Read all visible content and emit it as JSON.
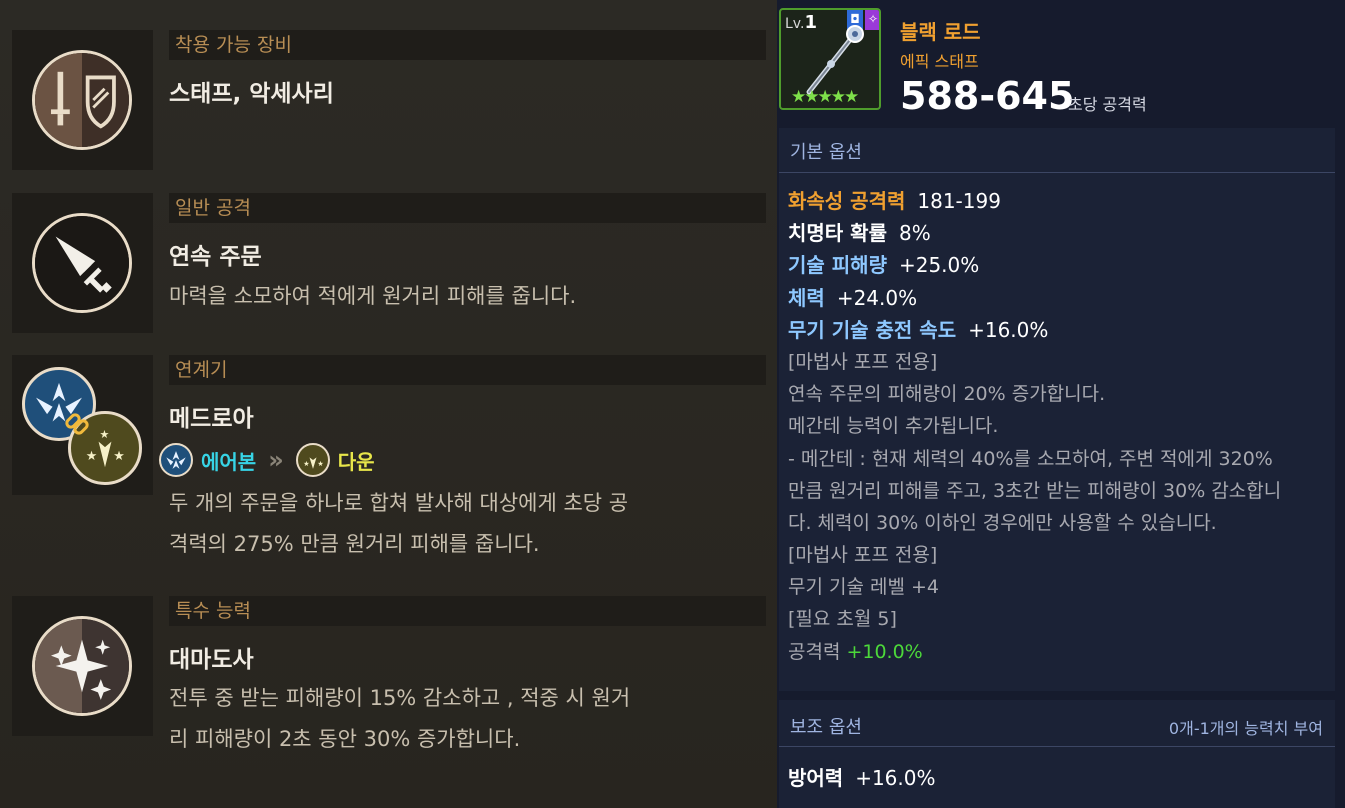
{
  "left": {
    "equip": {
      "header": "착용 가능 장비",
      "title": "스태프, 악세사리",
      "icon": "sword-shield-icon"
    },
    "normal_attack": {
      "header": "일반 공격",
      "title": "연속 주문",
      "desc": "마력을 소모하여 적에게 원거리 피해를 줍니다.",
      "icon": "sword-icon"
    },
    "combo": {
      "header": "연계기",
      "title": "메드로아",
      "skill_a": "에어본",
      "skill_b": "다운",
      "arrow": "»",
      "desc_line1": "두 개의 주문을 하나로 합쳐 발사해 대상에게 초당 공",
      "desc_line2": "격력의 275% 만큼 원거리 피해를 줍니다.",
      "icon": "chain-link-icon"
    },
    "special": {
      "header": "특수 능력",
      "title": "대마도사",
      "desc_line1": "전투 중 받는 피해량이 15% 감소하고 , 적중 시 원거",
      "desc_line2": "리 피해량이 2초 동안 30% 증가합니다.",
      "icon": "sparkle-icon"
    }
  },
  "item": {
    "level_prefix": "Lv.",
    "level": "1",
    "stars": "★★★★★",
    "name": "블랙 로드",
    "type": "에픽 스태프",
    "dps": "588-645",
    "dps_label": "초당 공격력"
  },
  "base_options": {
    "header": "기본 옵션",
    "rows": [
      {
        "key": "화속성 공격력",
        "value": "181-199",
        "key_color": "#f0a030"
      },
      {
        "key": "치명타 확률",
        "value": "8%",
        "key_color": "#ffffff"
      },
      {
        "key": "기술 피해량",
        "value": "+25.0%",
        "key_color": "#8ec8ff"
      },
      {
        "key": "체력",
        "value": "+24.0%",
        "key_color": "#8ec8ff"
      },
      {
        "key": "무기 기술 충전 속도",
        "value": "+16.0%",
        "key_color": "#8ec8ff"
      }
    ],
    "text_lines": [
      "[마법사 포프 전용]",
      "연속 주문의 피해량이 20% 증가합니다.",
      "메간테 능력이 추가됩니다.",
      "- 메간테 : 현재 체력의 40%를 소모하여, 주변 적에게 320%",
      "만큼 원거리 피해를 주고, 3초간 받는 피해량이 30% 감소합니",
      "다. 체력이 30% 이하인 경우에만 사용할 수 있습니다.",
      "[마법사 포프 전용]",
      "무기 기술 레벨 +4",
      "[필요 초월 5]"
    ],
    "last_row": {
      "key": "공격력",
      "value": "+10.0%"
    }
  },
  "sub_options": {
    "header": "보조 옵션",
    "note": "0개-1개의 능력치 부여",
    "row": {
      "key": "방어력",
      "value": "+16.0%"
    }
  },
  "colors": {
    "accent_orange": "#f0a030",
    "green": "#4cd83a",
    "blue_text": "#8ec8ff",
    "skill_a": "#37d4e6",
    "skill_b": "#e8e64a"
  }
}
